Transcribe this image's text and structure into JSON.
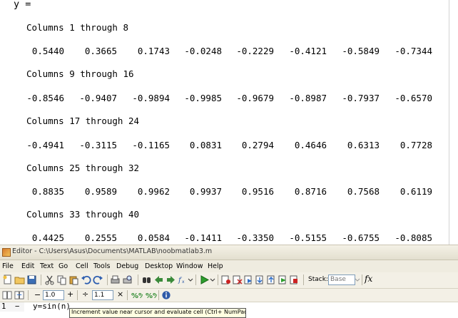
{
  "command_window": {
    "variable_line": "y =",
    "blocks": [
      {
        "header": "Columns 1 through 8",
        "values": [
          "0.5440",
          "0.3665",
          "0.1743",
          "-0.0248",
          "-0.2229",
          "-0.4121",
          "-0.5849",
          "-0.7344"
        ]
      },
      {
        "header": "Columns 9 through 16",
        "values": [
          "-0.8546",
          "-0.9407",
          "-0.9894",
          "-0.9985",
          "-0.9679",
          "-0.8987",
          "-0.7937",
          "-0.6570"
        ]
      },
      {
        "header": "Columns 17 through 24",
        "values": [
          "-0.4941",
          "-0.3115",
          "-0.1165",
          "0.0831",
          "0.2794",
          "0.4646",
          "0.6313",
          "0.7728"
        ]
      },
      {
        "header": "Columns 25 through 32",
        "values": [
          "0.8835",
          "0.9589",
          "0.9962",
          "0.9937",
          "0.9516",
          "0.8716",
          "0.7568",
          "0.6119"
        ]
      },
      {
        "header": "Columns 33 through 40",
        "values": [
          "0.4425",
          "0.2555",
          "0.0584",
          "-0.1411",
          "-0.3350",
          "-0.5155",
          "-0.6755",
          "-0.8085"
        ]
      }
    ]
  },
  "editor": {
    "title": "Editor - C:\\Users\\Asus\\Documents\\MATLAB\\noobmatlab3.m",
    "menu": [
      "File",
      "Edit",
      "Text",
      "Go",
      "Cell",
      "Tools",
      "Debug",
      "Desktop",
      "Window",
      "Help"
    ],
    "stack_label": "Stack:",
    "stack_value": "Base",
    "fx_label": "fx",
    "minus_label": "−",
    "plus_label": "+",
    "divide_label": "÷",
    "times_label": "×",
    "cell_value_1": "1.0",
    "cell_value_2": "1.1",
    "line_number": "1  −",
    "code": "y=sin(n)",
    "tooltip": "Increment value near cursor and evaluate cell (Ctrl+ NumPad +)"
  }
}
